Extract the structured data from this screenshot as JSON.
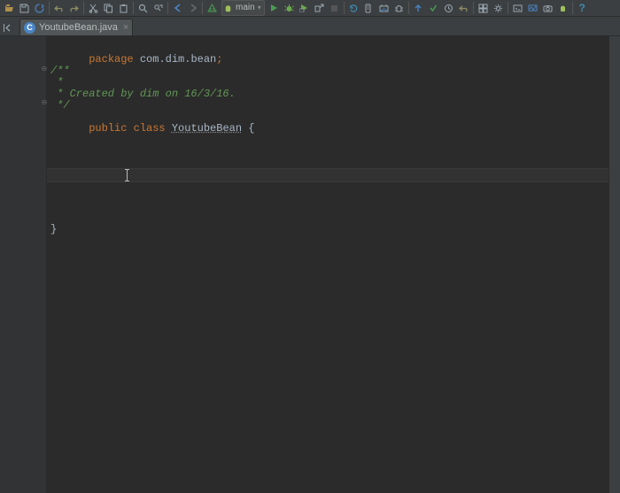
{
  "toolbar": {
    "run_config_label": "main"
  },
  "tab": {
    "filename": "YoutubeBean.java",
    "icon_letter": "C"
  },
  "code": {
    "l1_kw": "package",
    "l1_pkg": " com.dim.bean",
    "l1_semi": ";",
    "l2": "/**",
    "l3": " *",
    "l4": " * Created by dim on 16/3/16.",
    "l5": " */",
    "l6_kw": "public class ",
    "l6_cls": "YoutubeBean",
    "l6_rest": " {",
    "l_end": "}"
  }
}
